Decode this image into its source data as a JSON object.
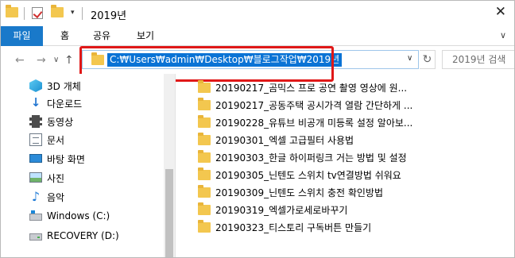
{
  "titlebar": {
    "title": "2019년",
    "close_glyph": "✕",
    "qa_dropdown_glyph": "▾"
  },
  "ribbon": {
    "tabs": [
      "파일",
      "홈",
      "공유",
      "보기"
    ],
    "expand_glyph": "∨"
  },
  "address": {
    "path": "C:₩Users₩admin₩Desktop₩블로그작업₩2019년",
    "dropdown_glyph": "∨",
    "refresh_glyph": "↻",
    "search_placeholder": "2019년 검색",
    "back_glyph": "←",
    "forward_glyph": "→",
    "history_glyph": "∨",
    "up_glyph": "↑"
  },
  "nav_pane": {
    "items": [
      {
        "label": "3D 개체",
        "icon": "3d-objects-icon"
      },
      {
        "label": "다운로드",
        "icon": "downloads-icon"
      },
      {
        "label": "동영상",
        "icon": "videos-icon"
      },
      {
        "label": "문서",
        "icon": "documents-icon"
      },
      {
        "label": "바탕 화면",
        "icon": "desktop-icon"
      },
      {
        "label": "사진",
        "icon": "pictures-icon"
      },
      {
        "label": "음악",
        "icon": "music-icon"
      },
      {
        "label": "Windows (C:)",
        "icon": "drive-icon"
      },
      {
        "label": "RECOVERY (D:)",
        "icon": "drive-icon"
      }
    ]
  },
  "files": [
    "20190217_곰믹스 프로 공연 촬영 영상에 원...",
    "20190217_공동주택 공시가격 열람 간단하게 ...",
    "20190228_유튜브 비공개 미등록 설정 알아보...",
    "20190301_엑셀 고급필터 사용법",
    "20190303_한글 하이퍼링크 거는 방법 및 설정",
    "20190305_닌텐도 스위치 tv연결방법 쉬워요",
    "20190309_닌텐도 스위치 충전 확인방법",
    "20190319_엑셀가로세로바꾸기",
    "20190323_티스토리 구독버튼 만들기"
  ],
  "colors": {
    "accent": "#1979ca",
    "selection": "#0a73d5",
    "highlight_frame": "#e01818",
    "folder": "#f3c74f"
  }
}
